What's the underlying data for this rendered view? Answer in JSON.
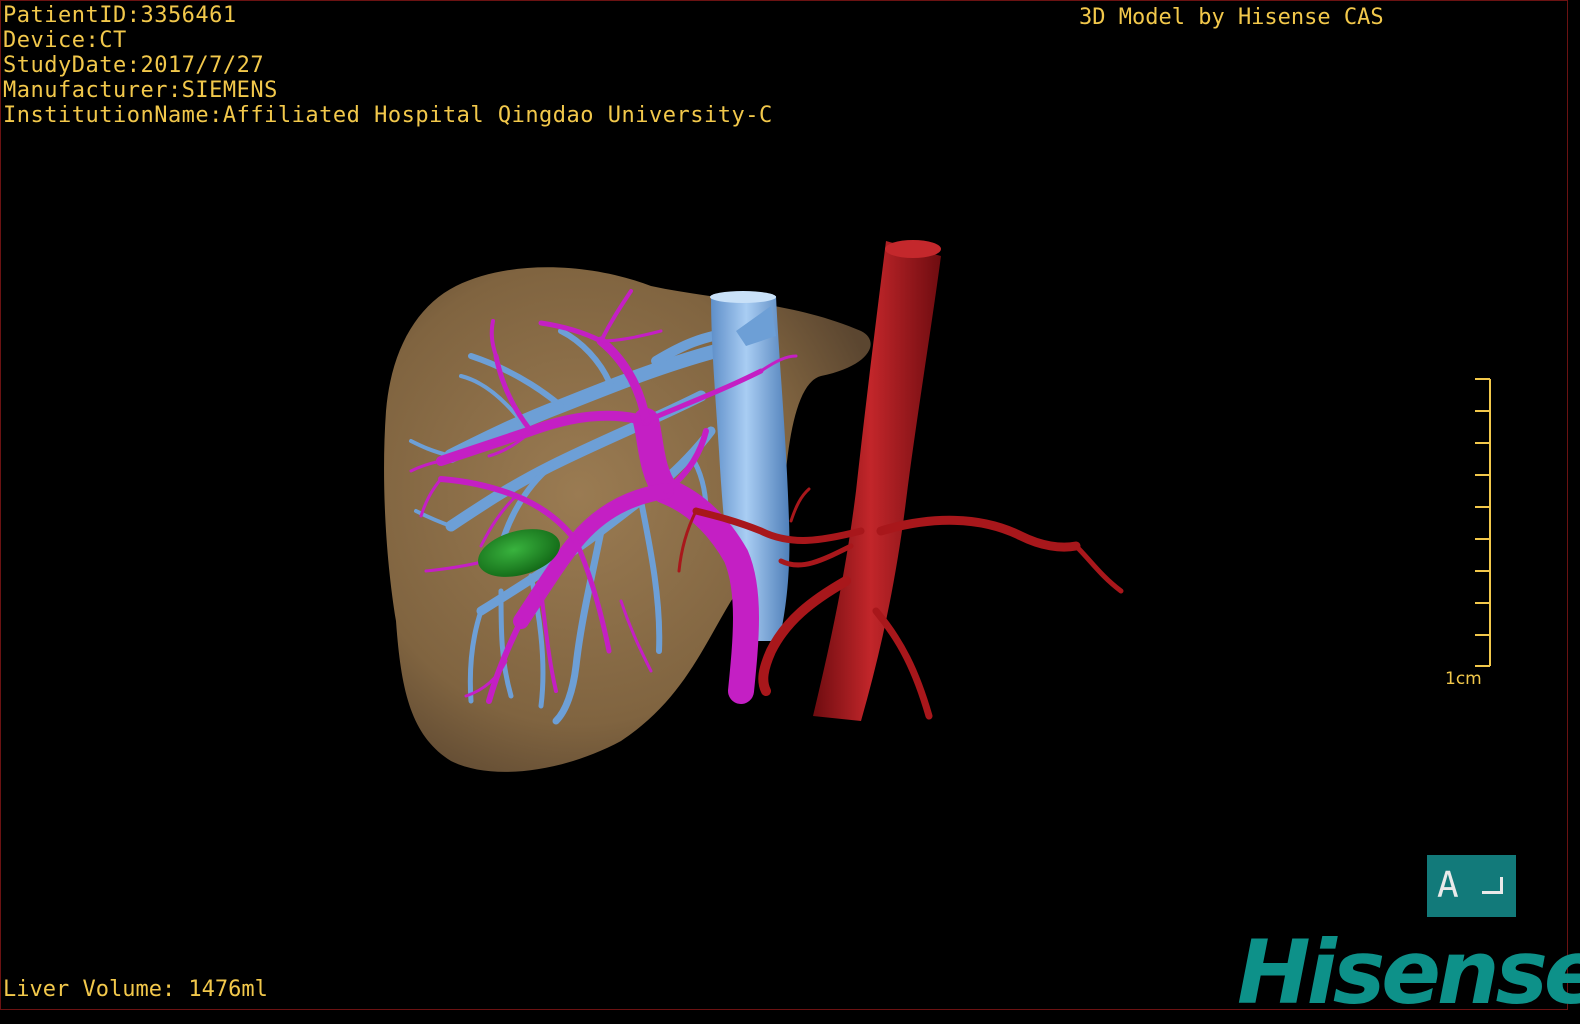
{
  "patient_info": {
    "patient_id": "PatientID:3356461",
    "device": "Device:CT",
    "study_date": "StudyDate:2017/7/27",
    "manufacturer": "Manufacturer:SIEMENS",
    "institution": "InstitutionName:Affiliated Hospital Qingdao University-C"
  },
  "credit": "3D Model by Hisense CAS",
  "liver_volume": "Liver Volume: 1476ml",
  "scale_bar": {
    "label": "1cm"
  },
  "orientation": {
    "label": "A"
  },
  "brand_logo": "Hisense",
  "colors": {
    "text": "#f2c84b",
    "liver": "#8a6d46",
    "portal_vein": "#c41fc4",
    "hepatic_vein": "#6d9fd6",
    "vena_cava": "#8ab8ea",
    "aorta": "#a8171b",
    "lesion": "#1f8a24",
    "orientation_box": "#127a7a",
    "logo": "#0d9189"
  }
}
